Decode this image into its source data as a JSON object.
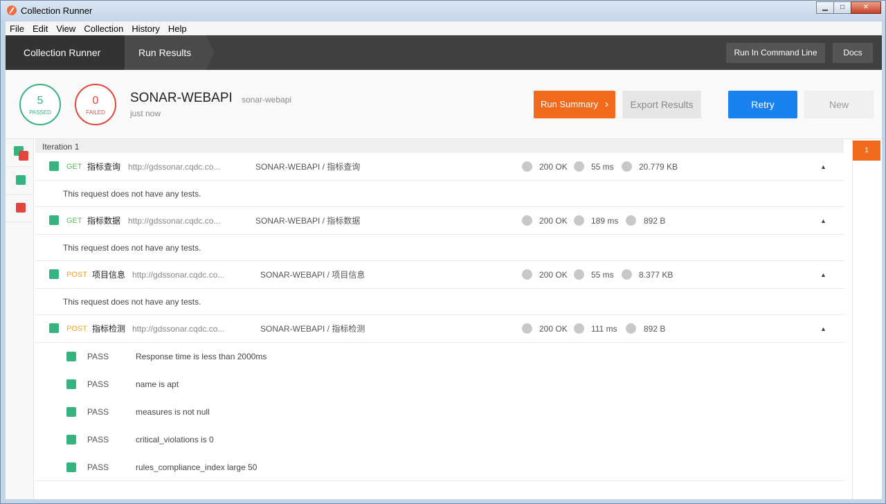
{
  "window": {
    "title": "Collection Runner"
  },
  "menu": [
    "File",
    "Edit",
    "View",
    "Collection",
    "History",
    "Help"
  ],
  "nav": {
    "breadcrumb1": "Collection Runner",
    "breadcrumb2": "Run Results",
    "run_cli": "Run In Command Line",
    "docs": "Docs"
  },
  "summary": {
    "passed_count": "5",
    "passed_label": "PASSED",
    "failed_count": "0",
    "failed_label": "FAILED",
    "collection_name": "SONAR-WEBAPI",
    "environment": "sonar-webapi",
    "time": "just now",
    "run_summary": "Run Summary",
    "export": "Export Results",
    "retry": "Retry",
    "new": "New"
  },
  "iteration": {
    "label": "Iteration 1",
    "badge": "1"
  },
  "requests": [
    {
      "method": "GET",
      "name": "指标查询",
      "url": "http://gdssonar.cqdc.co...",
      "path": "SONAR-WEBAPI / 指标查询",
      "status": "200 OK",
      "time": "55 ms",
      "size": "20.779 KB",
      "note": "This request does not have any tests."
    },
    {
      "method": "GET",
      "name": "指标数据",
      "url": "http://gdssonar.cqdc.co...",
      "path": "SONAR-WEBAPI / 指标数据",
      "status": "200 OK",
      "time": "189 ms",
      "size": "892 B",
      "note": "This request does not have any tests."
    },
    {
      "method": "POST",
      "name": "项目信息",
      "url": "http://gdssonar.cqdc.co...",
      "path": "SONAR-WEBAPI / 项目信息",
      "status": "200 OK",
      "time": "55 ms",
      "size": "8.377 KB",
      "note": "This request does not have any tests."
    },
    {
      "method": "POST",
      "name": "指标检测",
      "url": "http://gdssonar.cqdc.co...",
      "path": "SONAR-WEBAPI / 指标检测",
      "status": "200 OK",
      "time": "111 ms",
      "size": "892 B"
    }
  ],
  "tests": [
    {
      "status": "PASS",
      "name": "Response time is less than 2000ms"
    },
    {
      "status": "PASS",
      "name": "name is apt"
    },
    {
      "status": "PASS",
      "name": "measures is not null"
    },
    {
      "status": "PASS",
      "name": "critical_violations is 0"
    },
    {
      "status": "PASS",
      "name": "rules_compliance_index large 50"
    }
  ],
  "colors": {
    "pass": "#36b37e",
    "fail": "#e0463c",
    "accent": "#f26b1d",
    "primary": "#1a82f0",
    "get": "#5cb85c",
    "post": "#f0a227"
  }
}
